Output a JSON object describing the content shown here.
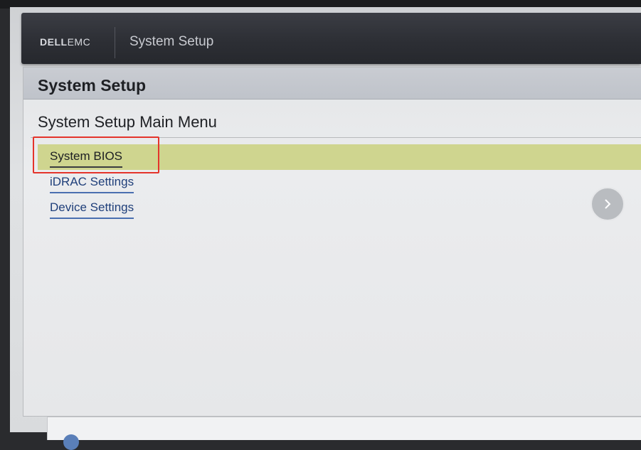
{
  "header": {
    "logo_brand": "DELL",
    "logo_suffix": "EMC",
    "title": "System Setup"
  },
  "panel": {
    "title": "System Setup",
    "menu_title": "System Setup Main Menu"
  },
  "menu": {
    "items": [
      {
        "label": "System BIOS",
        "selected": true
      },
      {
        "label": "iDRAC Settings",
        "selected": false
      },
      {
        "label": "Device Settings",
        "selected": false
      }
    ]
  },
  "colors": {
    "highlight": "#cfd58f",
    "annotation": "#e4342b",
    "header": "#2d2f35"
  },
  "icons": {
    "next": "chevron-right-icon",
    "footer": "info-icon"
  }
}
